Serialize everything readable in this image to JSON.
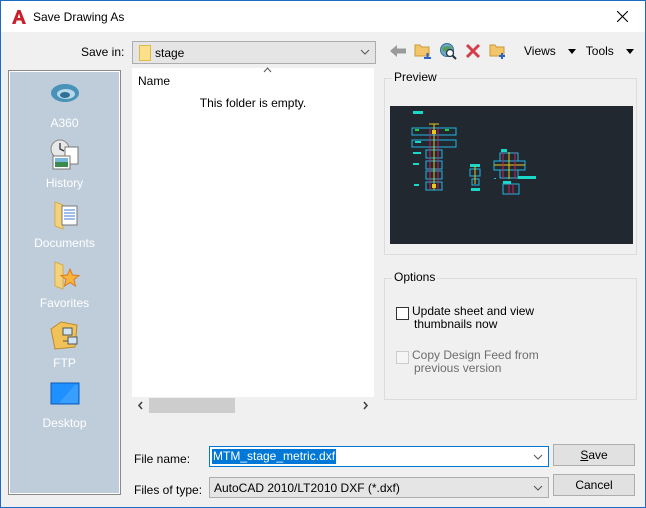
{
  "window": {
    "title": "Save Drawing As",
    "accent": "#1c6ac4"
  },
  "save_in": {
    "label": "Save in:",
    "value": "stage"
  },
  "toolbar": {
    "buttons": [
      {
        "name": "back",
        "icon": "back-arrow-icon"
      },
      {
        "name": "up-one-level",
        "icon": "folder-up-icon"
      },
      {
        "name": "search-web",
        "icon": "search-web-icon"
      },
      {
        "name": "delete",
        "icon": "delete-icon"
      },
      {
        "name": "create-new-folder",
        "icon": "new-folder-icon"
      }
    ],
    "views_label": "Views",
    "tools_label": "Tools"
  },
  "places": [
    {
      "label": "A360",
      "icon": "a360-icon"
    },
    {
      "label": "History",
      "icon": "history-icon"
    },
    {
      "label": "Documents",
      "icon": "documents-icon"
    },
    {
      "label": "Favorites",
      "icon": "favorites-icon"
    },
    {
      "label": "FTP",
      "icon": "ftp-icon"
    },
    {
      "label": "Desktop",
      "icon": "desktop-icon"
    }
  ],
  "file_list": {
    "column_name": "Name",
    "empty_message": "This folder is empty."
  },
  "preview": {
    "label": "Preview",
    "background": "#212830"
  },
  "options": {
    "label": "Options",
    "update_thumbnails": {
      "line1": "Update sheet and view",
      "line2": "thumbnails now",
      "checked": false,
      "enabled": true
    },
    "copy_design_feed": {
      "line1": "Copy Design Feed from",
      "line2": "previous version",
      "checked": false,
      "enabled": false
    }
  },
  "file_name": {
    "label": "File name:",
    "value": "MTM_stage_metric.dxf"
  },
  "files_of_type": {
    "label": "Files of type:",
    "value": "AutoCAD 2010/LT2010 DXF (*.dxf)"
  },
  "buttons": {
    "save": "Save",
    "save_mnemonic": "S",
    "save_rest": "ave",
    "cancel": "Cancel"
  }
}
